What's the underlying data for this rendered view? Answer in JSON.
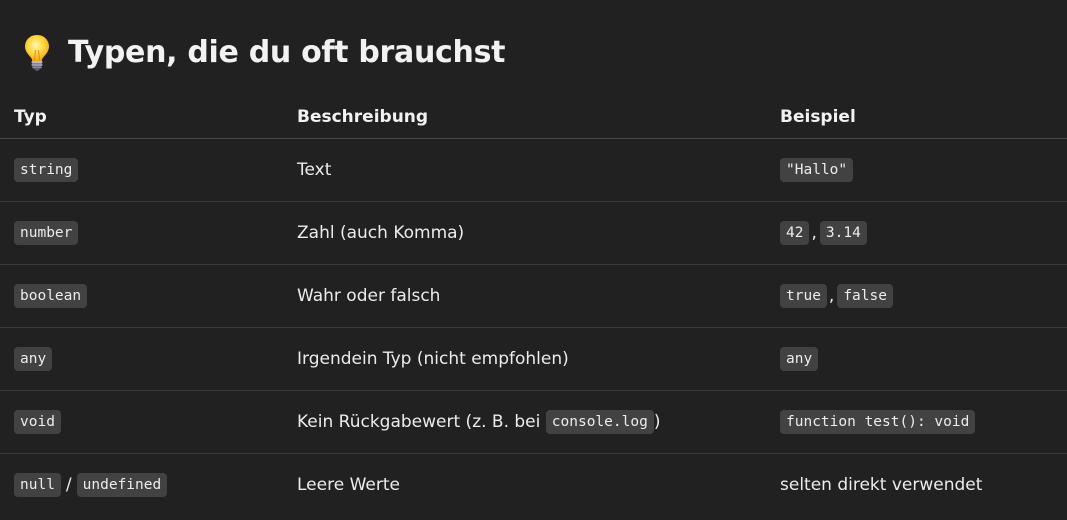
{
  "heading": {
    "icon": "lightbulb-icon",
    "title": "Typen, die du oft brauchst"
  },
  "table": {
    "headers": [
      "Typ",
      "Beschreibung",
      "Beispiel"
    ],
    "rows": [
      {
        "type": [
          "string"
        ],
        "type_sep": "",
        "description": "Text",
        "description_code": "",
        "description_suffix": "",
        "example": [
          "\"Hallo\""
        ],
        "example_sep": "",
        "example_text": ""
      },
      {
        "type": [
          "number"
        ],
        "type_sep": "",
        "description": "Zahl (auch Komma)",
        "description_code": "",
        "description_suffix": "",
        "example": [
          "42",
          "3.14"
        ],
        "example_sep": ",",
        "example_text": ""
      },
      {
        "type": [
          "boolean"
        ],
        "type_sep": "",
        "description": "Wahr oder falsch",
        "description_code": "",
        "description_suffix": "",
        "example": [
          "true",
          "false"
        ],
        "example_sep": ",",
        "example_text": ""
      },
      {
        "type": [
          "any"
        ],
        "type_sep": "",
        "description": "Irgendein Typ (nicht empfohlen)",
        "description_code": "",
        "description_suffix": "",
        "example": [
          "any"
        ],
        "example_sep": "",
        "example_text": ""
      },
      {
        "type": [
          "void"
        ],
        "type_sep": "",
        "description": "Kein Rückgabewert (z. B. bei ",
        "description_code": "console.log",
        "description_suffix": ")",
        "example": [
          "function test(): void"
        ],
        "example_sep": "",
        "example_text": ""
      },
      {
        "type": [
          "null",
          "undefined"
        ],
        "type_sep": "/",
        "description": "Leere Werte",
        "description_code": "",
        "description_suffix": "",
        "example": [],
        "example_sep": "",
        "example_text": "selten direkt verwendet"
      }
    ]
  },
  "colors": {
    "background": "#212121",
    "text": "#ececec",
    "code_background": "#424242",
    "divider": "#3a3a3a"
  }
}
